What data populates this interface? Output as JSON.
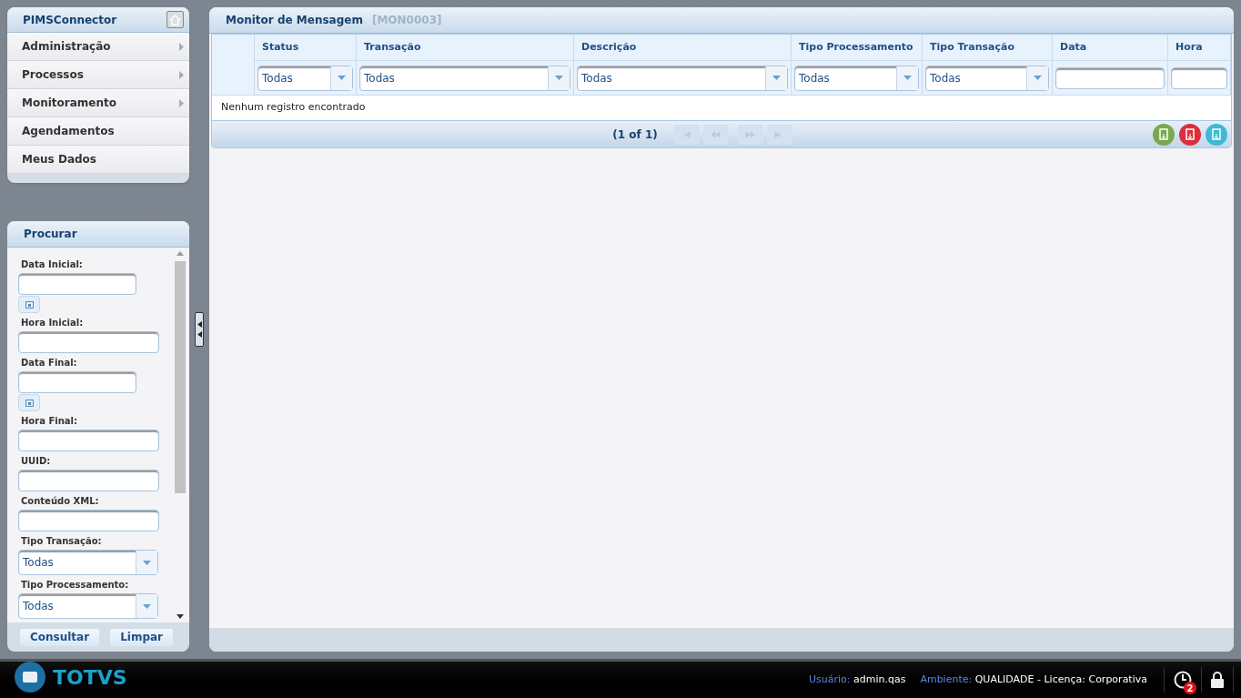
{
  "nav": {
    "title": "PIMSConnector",
    "items": [
      {
        "label": "Administração",
        "has_submenu": true
      },
      {
        "label": "Processos",
        "has_submenu": true
      },
      {
        "label": "Monitoramento",
        "has_submenu": true
      },
      {
        "label": "Agendamentos",
        "has_submenu": false
      },
      {
        "label": "Meus Dados",
        "has_submenu": false
      }
    ]
  },
  "search": {
    "title": "Procurar",
    "fields": [
      {
        "kind": "date",
        "label": "Data Inicial:"
      },
      {
        "kind": "text",
        "label": "Hora Inicial:"
      },
      {
        "kind": "date",
        "label": "Data Final:"
      },
      {
        "kind": "text",
        "label": "Hora Final:"
      },
      {
        "kind": "text",
        "label": "UUID:"
      },
      {
        "kind": "text",
        "label": "Conteúdo XML:"
      },
      {
        "kind": "select",
        "label": "Tipo Transação:",
        "value": "Todas"
      },
      {
        "kind": "select",
        "label": "Tipo Processamento:",
        "value": "Todas"
      }
    ],
    "buttons": [
      "Consultar",
      "Limpar"
    ]
  },
  "main": {
    "title": "Monitor de Mensagem",
    "code": "[MON0003]",
    "columns": [
      {
        "label": "Status",
        "filter": {
          "kind": "select",
          "value": "Todas"
        }
      },
      {
        "label": "Transação",
        "filter": {
          "kind": "select",
          "value": "Todas"
        }
      },
      {
        "label": "Descrição",
        "filter": {
          "kind": "select",
          "value": "Todas"
        }
      },
      {
        "label": "Tipo Processamento",
        "filter": {
          "kind": "select",
          "value": "Todas"
        }
      },
      {
        "label": "Tipo Transação",
        "filter": {
          "kind": "select",
          "value": "Todas"
        }
      },
      {
        "label": "Data",
        "filter": {
          "kind": "text"
        }
      },
      {
        "label": "Hora",
        "filter": {
          "kind": "text"
        }
      }
    ],
    "empty_message": "Nenhum registro encontrado",
    "pager": "(1 of 1)",
    "export_buttons": [
      {
        "color": "#7aa84f"
      },
      {
        "color": "#d9303a"
      },
      {
        "color": "#3fb8d6"
      }
    ]
  },
  "footer": {
    "logo": "TOTVS",
    "user_label": "Usuário:",
    "user": "admin.qas",
    "env_label": "Ambiente:",
    "env": "QUALIDADE - Licença: Corporativa",
    "notifications": "2"
  }
}
